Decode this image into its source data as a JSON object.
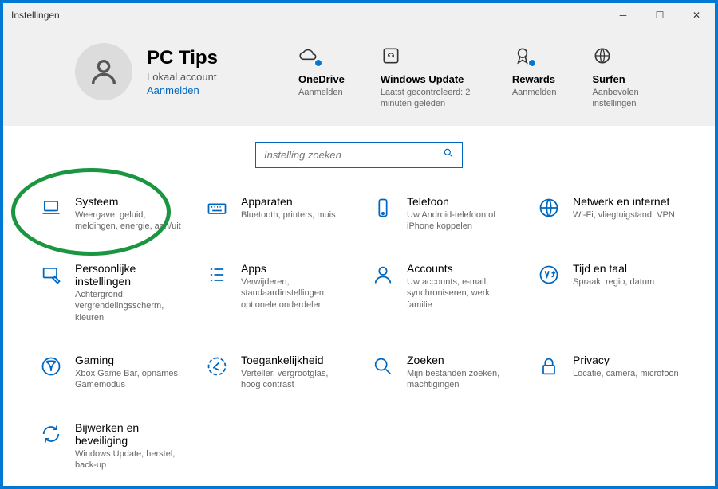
{
  "window": {
    "title": "Instellingen"
  },
  "profile": {
    "name": "PC Tips",
    "subtitle": "Lokaal account",
    "signin": "Aanmelden"
  },
  "headerTiles": {
    "onedrive": {
      "label": "OneDrive",
      "sub": "Aanmelden"
    },
    "update": {
      "label": "Windows Update",
      "sub": "Laatst gecontroleerd: 2 minuten geleden"
    },
    "rewards": {
      "label": "Rewards",
      "sub": "Aanmelden"
    },
    "browsing": {
      "label": "Surfen",
      "sub": "Aanbevolen instellingen"
    }
  },
  "search": {
    "placeholder": "Instelling zoeken"
  },
  "categories": [
    {
      "key": "system",
      "title": "Systeem",
      "desc": "Weergave, geluid, meldingen, energie, aan/uit",
      "highlight": true
    },
    {
      "key": "devices",
      "title": "Apparaten",
      "desc": "Bluetooth, printers, muis"
    },
    {
      "key": "phone",
      "title": "Telefoon",
      "desc": "Uw Android-telefoon of iPhone koppelen"
    },
    {
      "key": "network",
      "title": "Netwerk en internet",
      "desc": "Wi-Fi, vliegtuigstand, VPN"
    },
    {
      "key": "personalization",
      "title": "Persoonlijke instellingen",
      "desc": "Achtergrond, vergrendelingsscherm, kleuren"
    },
    {
      "key": "apps",
      "title": "Apps",
      "desc": "Verwijderen, standaardinstellingen, optionele onderdelen"
    },
    {
      "key": "accounts",
      "title": "Accounts",
      "desc": "Uw accounts, e-mail, synchroniseren, werk, familie"
    },
    {
      "key": "time",
      "title": "Tijd en taal",
      "desc": "Spraak, regio, datum"
    },
    {
      "key": "gaming",
      "title": "Gaming",
      "desc": "Xbox Game Bar, opnames, Gamemodus"
    },
    {
      "key": "ease",
      "title": "Toegankelijkheid",
      "desc": "Verteller, vergrootglas, hoog contrast"
    },
    {
      "key": "search",
      "title": "Zoeken",
      "desc": "Mijn bestanden zoeken, machtigingen"
    },
    {
      "key": "privacy",
      "title": "Privacy",
      "desc": "Locatie, camera, microfoon"
    },
    {
      "key": "updatesec",
      "title": "Bijwerken en beveiliging",
      "desc": "Windows Update, herstel, back-up"
    }
  ]
}
